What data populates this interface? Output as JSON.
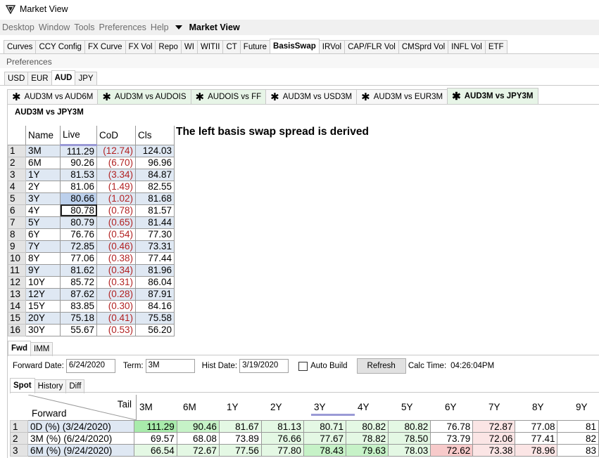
{
  "window": {
    "title": "Market View"
  },
  "menu": {
    "items": [
      "Desktop",
      "Window",
      "Tools",
      "Preferences",
      "Help"
    ],
    "view_label": "Market View"
  },
  "main_tabs": [
    "Curves",
    "CCY Config",
    "FX Curve",
    "FX Vol",
    "Repo",
    "WI",
    "WITII",
    "CT",
    "Future",
    "BasisSwap",
    "IRVol",
    "CAP/FLR Vol",
    "CMSprd Vol",
    "INFL Vol",
    "ETF"
  ],
  "main_tabs_active": "BasisSwap",
  "preferences_label": "Preferences",
  "ccy_tabs": [
    "USD",
    "EUR",
    "AUD",
    "JPY"
  ],
  "ccy_active": "AUD",
  "pair_tabs": [
    "AUD3M vs AUD6M",
    "AUD3M vs AUDOIS",
    "AUDOIS vs FF",
    "AUD3M vs USD3M",
    "AUD3M vs EUR3M",
    "AUD3M vs JPY3M"
  ],
  "pair_active": "AUD3M vs JPY3M",
  "pair_title": "AUD3M vs JPY3M",
  "note": "The left basis swap spread is derived",
  "live_table": {
    "headers": [
      "Name",
      "Live",
      "CoD",
      "Cls"
    ],
    "rows": [
      {
        "idx": "1",
        "name": "3M",
        "live": "111.29",
        "cod": "(12.74)",
        "cls": "124.03"
      },
      {
        "idx": "2",
        "name": "6M",
        "live": "90.26",
        "cod": "(6.70)",
        "cls": "96.96"
      },
      {
        "idx": "3",
        "name": "1Y",
        "live": "81.53",
        "cod": "(3.34)",
        "cls": "84.87"
      },
      {
        "idx": "4",
        "name": "2Y",
        "live": "81.06",
        "cod": "(1.49)",
        "cls": "82.55"
      },
      {
        "idx": "5",
        "name": "3Y",
        "live": "80.66",
        "cod": "(1.02)",
        "cls": "81.68"
      },
      {
        "idx": "6",
        "name": "4Y",
        "live": "80.78",
        "cod": "(0.78)",
        "cls": "81.57"
      },
      {
        "idx": "7",
        "name": "5Y",
        "live": "80.79",
        "cod": "(0.65)",
        "cls": "81.44"
      },
      {
        "idx": "8",
        "name": "6Y",
        "live": "76.76",
        "cod": "(0.54)",
        "cls": "77.30"
      },
      {
        "idx": "9",
        "name": "7Y",
        "live": "72.85",
        "cod": "(0.46)",
        "cls": "73.31"
      },
      {
        "idx": "10",
        "name": "8Y",
        "live": "77.06",
        "cod": "(0.38)",
        "cls": "77.44"
      },
      {
        "idx": "11",
        "name": "9Y",
        "live": "81.62",
        "cod": "(0.34)",
        "cls": "81.96"
      },
      {
        "idx": "12",
        "name": "10Y",
        "live": "85.72",
        "cod": "(0.31)",
        "cls": "86.04"
      },
      {
        "idx": "13",
        "name": "12Y",
        "live": "87.62",
        "cod": "(0.28)",
        "cls": "87.91"
      },
      {
        "idx": "14",
        "name": "15Y",
        "live": "83.85",
        "cod": "(0.30)",
        "cls": "84.16"
      },
      {
        "idx": "15",
        "name": "20Y",
        "live": "75.18",
        "cod": "(0.41)",
        "cls": "75.58"
      },
      {
        "idx": "16",
        "name": "30Y",
        "live": "55.67",
        "cod": "(0.53)",
        "cls": "56.20"
      }
    ]
  },
  "fwd_tabs": [
    "Fwd",
    "IMM"
  ],
  "fwd_active": "Fwd",
  "form": {
    "forward_date_label": "Forward Date:",
    "forward_date": "6/24/2020",
    "term_label": "Term:",
    "term": "3M",
    "hist_date_label": "Hist Date:",
    "hist_date": "3/19/2020",
    "auto_build_label": "Auto Build",
    "refresh_label": "Refresh",
    "calc_time_label": "Calc Time:",
    "calc_time": "04:26:04PM"
  },
  "spot_tabs": [
    "Spot",
    "History",
    "Diff"
  ],
  "spot_active": "Spot",
  "fwd_table": {
    "corner_top": "Tail",
    "corner_bottom": "Forward",
    "columns": [
      "3M",
      "6M",
      "1Y",
      "2Y",
      "3Y",
      "4Y",
      "5Y",
      "6Y",
      "7Y",
      "8Y",
      "9Y"
    ],
    "rows": [
      {
        "idx": "1",
        "name": "0D (%) (3/24/2020)",
        "values": [
          "111.29",
          "90.46",
          "81.67",
          "81.13",
          "80.71",
          "80.82",
          "80.82",
          "76.78",
          "72.87",
          "77.08",
          "81"
        ]
      },
      {
        "idx": "2",
        "name": "3M (%) (6/24/2020)",
        "values": [
          "69.57",
          "68.08",
          "73.89",
          "76.66",
          "77.67",
          "78.82",
          "78.50",
          "73.79",
          "72.06",
          "77.41",
          "82"
        ]
      },
      {
        "idx": "3",
        "name": "6M (%) (9/24/2020)",
        "values": [
          "66.54",
          "72.67",
          "77.56",
          "77.80",
          "78.43",
          "79.63",
          "78.03",
          "72.62",
          "73.38",
          "78.96",
          "83"
        ]
      }
    ]
  }
}
